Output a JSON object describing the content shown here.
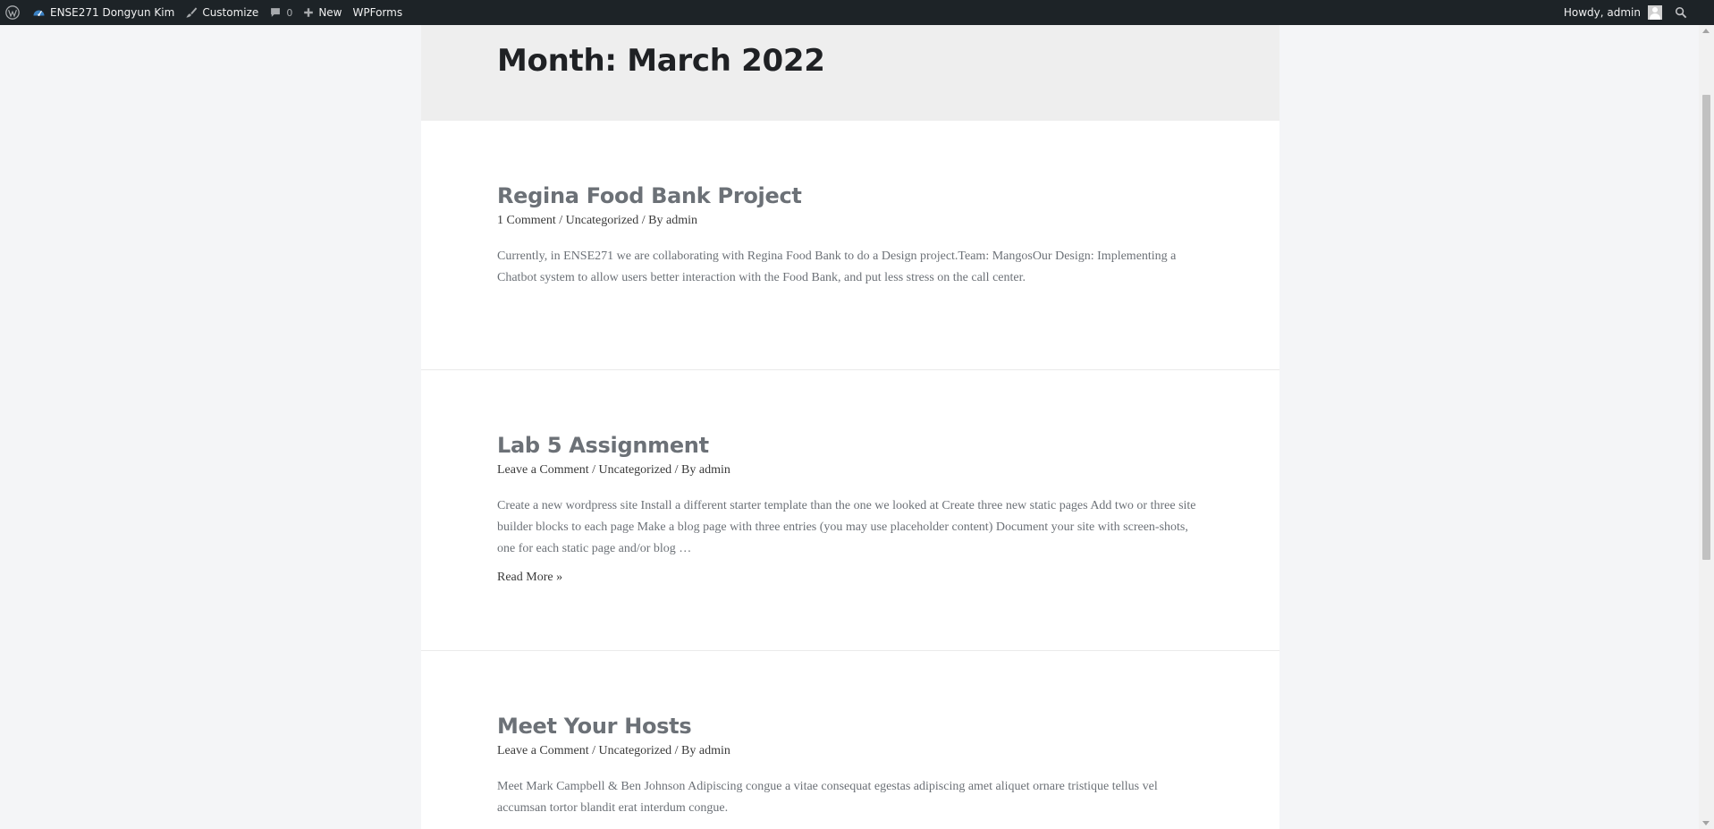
{
  "adminbar": {
    "site_name": "ENSE271 Dongyun Kim",
    "customize": "Customize",
    "comments_count": "0",
    "new": "New",
    "wpforms": "WPForms",
    "howdy": "Howdy, admin"
  },
  "archive": {
    "title": "Month: March 2022"
  },
  "posts": [
    {
      "title": "Regina Food Bank Project",
      "comments": "1 Comment",
      "category": "Uncategorized",
      "by": "By",
      "author": "admin",
      "excerpt": "Currently, in ENSE271 we are collaborating with Regina Food Bank to do a Design project.Team: MangosOur Design: Implementing a Chatbot system to allow users better interaction with the Food Bank, and put less stress on the call center."
    },
    {
      "title": "Lab 5 Assignment",
      "comments": "Leave a Comment",
      "category": "Uncategorized",
      "by": "By",
      "author": "admin",
      "excerpt": "Create a new wordpress site Install a different starter template than the one we looked at Create three new static pages Add two or three site builder blocks to each page Make a blog page with three entries (you may use placeholder content) Document your site with screen-shots, one for each static page and/or blog …",
      "read_more": "Read More »"
    },
    {
      "title": "Meet Your Hosts",
      "comments": "Leave a Comment",
      "category": "Uncategorized",
      "by": "By",
      "author": "admin",
      "excerpt": "Meet Mark Campbell & Ben Johnson Adipiscing congue a vitae consequat egestas adipiscing amet aliquet ornare tristique tellus vel accumsan tortor blandit erat interdum congue."
    }
  ],
  "icons": {
    "wp_logo": "wordpress-icon",
    "site": "dashboard-icon",
    "customize": "paintbrush-icon",
    "comments": "comment-bubble-icon",
    "new": "plus-icon",
    "search": "search-icon"
  },
  "colors": {
    "adminbar_bg": "#1d2327",
    "header_bg": "#eeeeee",
    "page_bg": "#f4f5f7",
    "post_title": "#6c7177"
  }
}
